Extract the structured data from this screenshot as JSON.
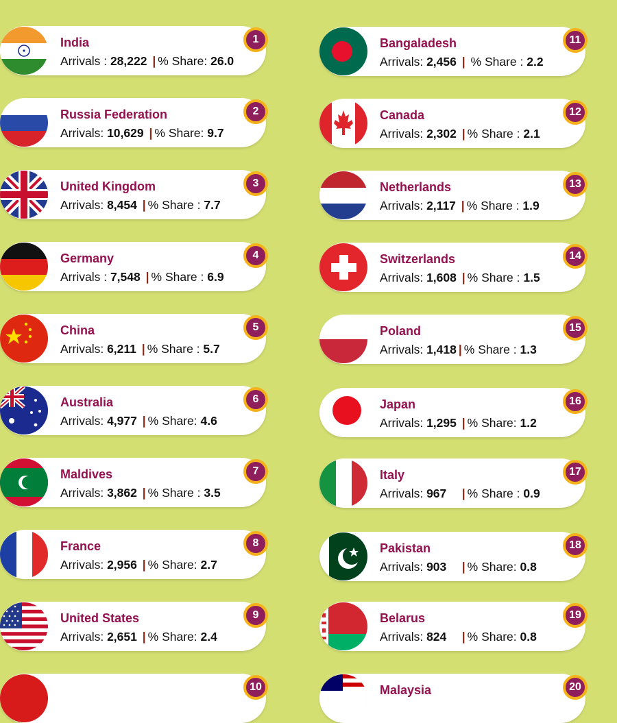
{
  "labels": {
    "arrivals": "Arrivals",
    "share": "% Share",
    "separator": "|"
  },
  "left": [
    {
      "rank": "1",
      "country": "India",
      "arrivals": "28,222",
      "share": "26.0",
      "flag_icon": "india-flag-icon"
    },
    {
      "rank": "2",
      "country": "Russia Federation",
      "arrivals": "10,629",
      "share": "9.7",
      "flag_icon": "russia-flag-icon"
    },
    {
      "rank": "3",
      "country": "United Kingdom",
      "arrivals": "8,454",
      "share": "7.7",
      "flag_icon": "uk-flag-icon"
    },
    {
      "rank": "4",
      "country": "Germany",
      "arrivals": "7,548",
      "share": "6.9",
      "flag_icon": "germany-flag-icon"
    },
    {
      "rank": "5",
      "country": "China",
      "arrivals": "6,211",
      "share": "5.7",
      "flag_icon": "china-flag-icon"
    },
    {
      "rank": "6",
      "country": "Australia",
      "arrivals": "4,977",
      "share": "4.6",
      "flag_icon": "australia-flag-icon"
    },
    {
      "rank": "7",
      "country": "Maldives",
      "arrivals": "3,862",
      "share": "3.5",
      "flag_icon": "maldives-flag-icon"
    },
    {
      "rank": "8",
      "country": "France",
      "arrivals": "2,956",
      "share": "2.7",
      "flag_icon": "france-flag-icon"
    },
    {
      "rank": "9",
      "country": "United States",
      "arrivals": "2,651",
      "share": "2.4",
      "flag_icon": "usa-flag-icon"
    },
    {
      "rank": "10",
      "country": "",
      "arrivals": "",
      "share": "",
      "flag_icon": "turkey-flag-icon"
    }
  ],
  "right": [
    {
      "rank": "11",
      "country": "Bangaladesh",
      "arrivals": "2,456",
      "share": "2.2",
      "flag_icon": "bangladesh-flag-icon"
    },
    {
      "rank": "12",
      "country": "Canada",
      "arrivals": "2,302",
      "share": "2.1",
      "flag_icon": "canada-flag-icon"
    },
    {
      "rank": "13",
      "country": "Netherlands",
      "arrivals": "2,117",
      "share": "1.9",
      "flag_icon": "netherlands-flag-icon"
    },
    {
      "rank": "14",
      "country": "Switzerlands",
      "arrivals": "1,608",
      "share": "1.5",
      "flag_icon": "switzerland-flag-icon"
    },
    {
      "rank": "15",
      "country": "Poland",
      "arrivals": "1,418",
      "share": "1.3",
      "flag_icon": "poland-flag-icon"
    },
    {
      "rank": "16",
      "country": "Japan",
      "arrivals": "1,295",
      "share": "1.2",
      "flag_icon": "japan-flag-icon"
    },
    {
      "rank": "17",
      "country": "Italy",
      "arrivals": "967",
      "share": "0.9",
      "flag_icon": "italy-flag-icon"
    },
    {
      "rank": "18",
      "country": "Pakistan",
      "arrivals": "903",
      "share": "0.8",
      "flag_icon": "pakistan-flag-icon"
    },
    {
      "rank": "19",
      "country": "Belarus",
      "arrivals": "824",
      "share": "0.8",
      "flag_icon": "belarus-flag-icon"
    },
    {
      "rank": "20",
      "country": "Malaysia",
      "arrivals": "",
      "share": "",
      "flag_icon": "malaysia-flag-icon"
    }
  ]
}
